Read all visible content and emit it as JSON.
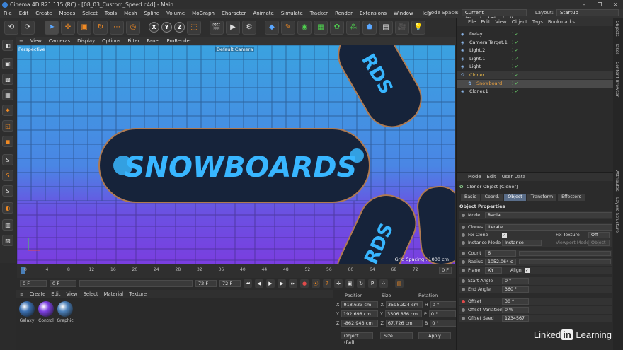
{
  "window": {
    "title": "Cinema 4D R21.115 (RC) - [08_03_Custom_Speed.c4d] - Main",
    "controls": [
      "–",
      "❐",
      "✕"
    ]
  },
  "menubar": {
    "items": [
      "File",
      "Edit",
      "Create",
      "Modes",
      "Select",
      "Tools",
      "Mesh",
      "Spline",
      "Volume",
      "MoGraph",
      "Character",
      "Animate",
      "Simulate",
      "Tracker",
      "Render",
      "Extensions",
      "Window",
      "Help"
    ],
    "node_space_label": "Node Space:",
    "node_space_value": "Current (Standard/Physical)",
    "layout_label": "Layout:",
    "layout_value": "Startup"
  },
  "toolbar": {
    "axis_x": "X",
    "axis_y": "Y",
    "axis_z": "Z"
  },
  "viewport": {
    "menu": [
      "View",
      "Cameras",
      "Display",
      "Options",
      "Filter",
      "Panel",
      "ProRender"
    ],
    "label": "Perspective",
    "camera": "Default Camera",
    "grid_spacing": "Grid Spacing : 1000 cm",
    "board_text": "SNOWBOARDS",
    "board_text_small": "RDS",
    "colors": {
      "sky_top": "#3aa2e0",
      "floor_bottom": "#7a3ee0",
      "board_fill": "#1a2a40",
      "board_text": "#38b6ff"
    }
  },
  "timeline": {
    "ticks": [
      "0",
      "4",
      "8",
      "12",
      "16",
      "20",
      "24",
      "28",
      "32",
      "36",
      "40",
      "44",
      "48",
      "52",
      "56",
      "60",
      "64",
      "68",
      "72"
    ],
    "end_frame_field": "0 F"
  },
  "playback": {
    "start": "0 F",
    "current": "0 F",
    "end_a": "72 F",
    "end_b": "72 F"
  },
  "materials": {
    "menu": [
      "Create",
      "Edit",
      "View",
      "Select",
      "Material",
      "Texture"
    ],
    "items": [
      {
        "name": "Galaxy",
        "color": "#3a6fb0"
      },
      {
        "name": "Control",
        "color": "#7b3fe0"
      },
      {
        "name": "Graphic",
        "color": "#4a7fb8"
      }
    ]
  },
  "coordinates": {
    "headers": [
      "Position",
      "Size",
      "Rotation"
    ],
    "rows": [
      {
        "axis": "X",
        "pos": "918.633 cm",
        "size_axis": "X",
        "size": "3595.324 cm",
        "rot_axis": "H",
        "rot": "0 °"
      },
      {
        "axis": "Y",
        "pos": "192.698 cm",
        "size_axis": "Y",
        "size": "3306.856 cm",
        "rot_axis": "P",
        "rot": "0 °"
      },
      {
        "axis": "Z",
        "pos": "-862.943 cm",
        "size_axis": "Z",
        "size": "67.726 cm",
        "rot_axis": "B",
        "rot": "0 °"
      }
    ],
    "mode": "Object (Rel)",
    "size_mode": "Size",
    "apply": "Apply"
  },
  "object_manager": {
    "menu": [
      "File",
      "Edit",
      "View",
      "Object",
      "Tags",
      "Bookmarks"
    ],
    "objects": [
      {
        "name": "Delay",
        "color": "#e0e0e0"
      },
      {
        "name": "Camera.Target.1",
        "color": "#e0e0e0"
      },
      {
        "name": "Light.2",
        "color": "#e0e0e0"
      },
      {
        "name": "Light.1",
        "color": "#e0e0e0"
      },
      {
        "name": "Light",
        "color": "#e0e0e0"
      },
      {
        "name": "Cloner",
        "color": "#e8b84a"
      },
      {
        "name": "Snowboard",
        "color": "#e8a040"
      },
      {
        "name": "Cloner.1",
        "color": "#e0e0e0"
      }
    ]
  },
  "side_tabs": [
    "Objects",
    "Takes",
    "Content Browser",
    "Attributes",
    "Layers",
    "Structure"
  ],
  "attributes": {
    "menu": [
      "Mode",
      "Edit",
      "User Data"
    ],
    "title": "Cloner Object [Cloner]",
    "tabs": [
      "Basic",
      "Coord.",
      "Object",
      "Transform",
      "Effectors"
    ],
    "active_tab": "Object",
    "section": "Object Properties",
    "mode_label": "Mode",
    "mode_value": "Radial",
    "clones_label": "Clones",
    "clones_value": "Iterate",
    "fix_clone_label": "Fix Clone",
    "fix_texture_label": "Fix Texture",
    "fix_texture_value": "Off",
    "instance_mode_label": "Instance Mode",
    "instance_mode_value": "Instance",
    "viewport_mode_label": "Viewport Mode",
    "viewport_mode_value": "Object",
    "count_label": "Count",
    "count_value": "6",
    "radius_label": "Radius",
    "radius_value": "1052.064 c",
    "plane_label": "Plane",
    "plane_value": "XY",
    "align_label": "Align",
    "start_angle_label": "Start Angle",
    "start_angle_value": "0 °",
    "end_angle_label": "End Angle",
    "end_angle_value": "360 °",
    "offset_label": "Offset",
    "offset_value": "30 °",
    "offset_variation_label": "Offset Variation",
    "offset_variation_value": "0 %",
    "offset_seed_label": "Offset Seed",
    "offset_seed_value": "1234567"
  },
  "watermark": {
    "brand_left": "Linked",
    "brand_in": "in",
    "brand_right": "Learning"
  }
}
